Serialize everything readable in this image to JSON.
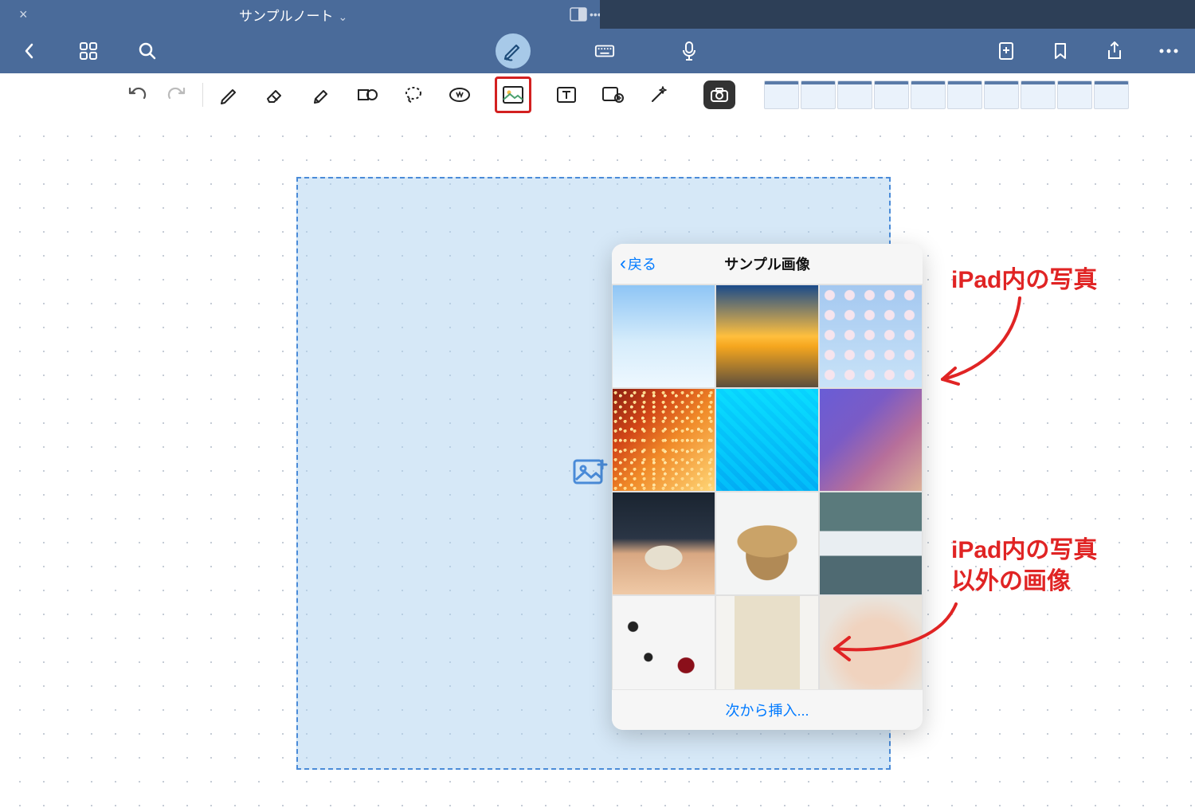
{
  "statusbar": {
    "title": "サンプルノート"
  },
  "popover": {
    "back_label": "戻る",
    "title": "サンプル画像",
    "footer_link": "次から挿入...",
    "images": [
      {
        "name": "winter-tree"
      },
      {
        "name": "sunset-beach"
      },
      {
        "name": "cherry-blossom"
      },
      {
        "name": "autumn-leaves"
      },
      {
        "name": "pool-water"
      },
      {
        "name": "gradient-purple"
      },
      {
        "name": "pebble-hand"
      },
      {
        "name": "straw-hat"
      },
      {
        "name": "knit-sweater"
      },
      {
        "name": "makeup-flatlay"
      },
      {
        "name": "canvas-bag"
      },
      {
        "name": "baby-hands"
      }
    ]
  },
  "annotations": {
    "photos_label": "iPad内の写真",
    "other_images_label": "iPad内の写真\n以外の画像"
  },
  "toolbar": {
    "icons": [
      "pen",
      "eraser",
      "highlighter",
      "shape",
      "lasso",
      "stamp",
      "image",
      "text",
      "sticker",
      "magic"
    ]
  },
  "thumbnails_count": 10
}
